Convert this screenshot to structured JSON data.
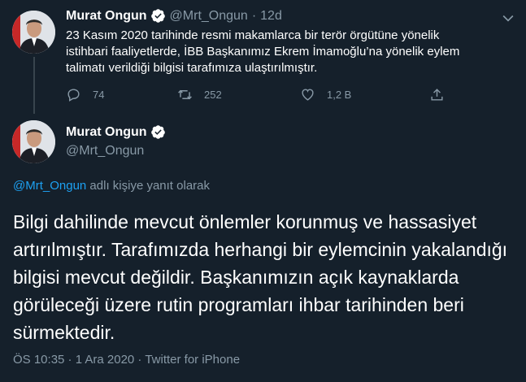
{
  "first_tweet": {
    "display_name": "Murat Ongun",
    "handle": "@Mrt_Ongun",
    "separator": "·",
    "time": "12d",
    "text": "23 Kasım 2020 tarihinde resmi makamlarca bir terör örgütüne yönelik istihbari faaliyetlerde, İBB Başkanımız Ekrem İmamoğlu’na yönelik eylem talimatı verildiği bilgisi tarafımıza ulaştırılmıştır.",
    "replies": "74",
    "retweets": "252",
    "likes": "1,2 B"
  },
  "main_tweet": {
    "display_name": "Murat Ongun",
    "handle": "@Mrt_Ongun",
    "reply_mention": "@Mrt_Ongun",
    "reply_suffix": " adlı kişiye yanıt olarak",
    "text": "Bilgi dahilinde mevcut önlemler korunmuş ve hassasiyet artırılmıştır. Tarafımızda herhangi bir eylemcinin yakalandığı bilgisi mevcut değildir. Başkanımızın açık kaynaklarda görüleceği üzere rutin programları ihbar tarihinden beri sürmektedir.",
    "timestamp": "ÖS 10:35 · 1 Ara 2020 · Twitter for iPhone"
  },
  "colors": {
    "background": "#15202b",
    "text": "#ffffff",
    "secondary": "#8899a6",
    "accent": "#1da1f2"
  },
  "icons": [
    "verified-badge-icon",
    "reply-icon",
    "retweet-icon",
    "like-icon",
    "share-icon",
    "chevron-down-icon"
  ]
}
